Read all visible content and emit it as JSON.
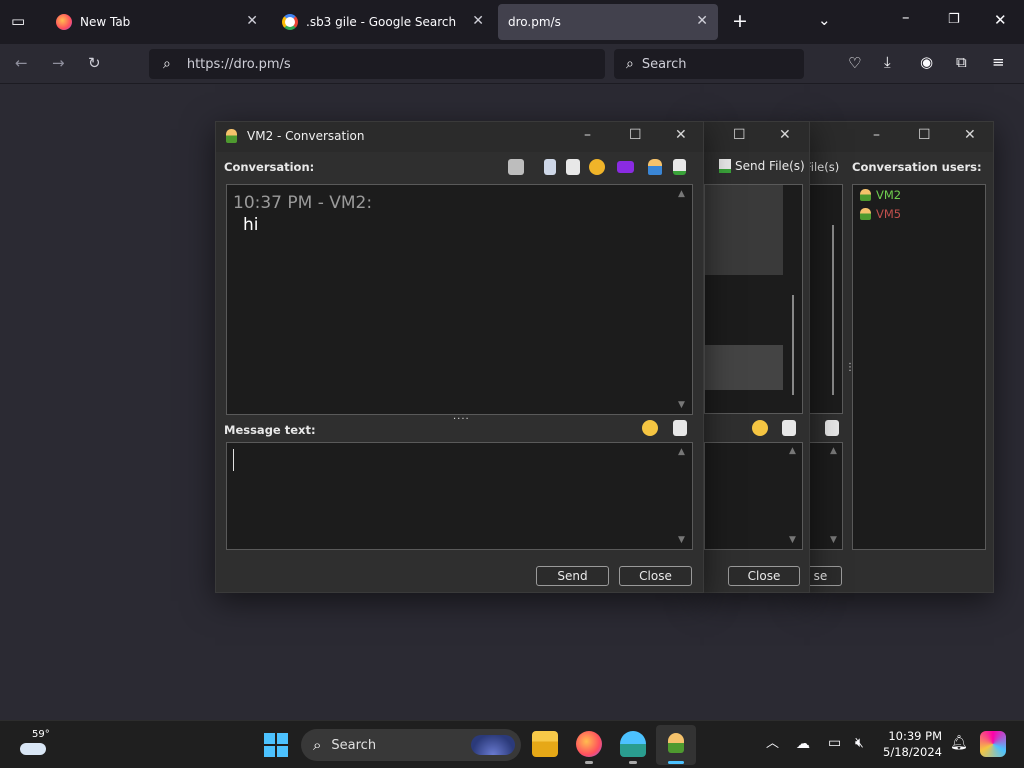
{
  "browser": {
    "tabs": [
      {
        "title": "New Tab"
      },
      {
        "title": ".sb3 gile - Google Search"
      },
      {
        "title": "dro.pm/s"
      }
    ],
    "url": "https://dro.pm/s",
    "search_placeholder": "Search"
  },
  "conversation_window": {
    "title": "VM2 - Conversation",
    "conversation_label": "Conversation:",
    "messages": [
      {
        "header": "10:37 PM - VM2:",
        "text": "hi"
      }
    ],
    "message_text_label": "Message text:",
    "send_label": "Send",
    "close_label": "Close"
  },
  "back_window_1": {
    "send_files_label": "Send File(s)",
    "close_label": "Close"
  },
  "back_window_2": {
    "files_label": "File(s)",
    "conversation_users_label": "Conversation users:",
    "users": [
      {
        "name": "VM2",
        "color": "#6fcf4f"
      },
      {
        "name": "VM5",
        "color": "#c0504d"
      }
    ],
    "close_label": "se"
  },
  "taskbar": {
    "weather_temp": "59°",
    "search_placeholder": "Search",
    "time": "10:39 PM",
    "date": "5/18/2024"
  }
}
